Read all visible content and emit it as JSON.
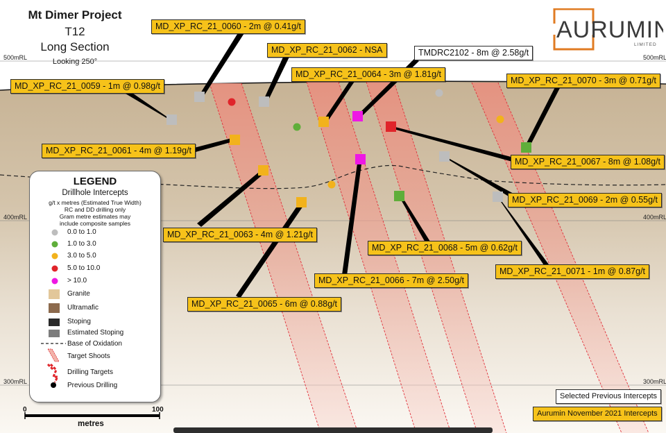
{
  "title": {
    "project": "Mt Dimer Project",
    "prospect": "T12",
    "section": "Long Section",
    "looking": "Looking 250°"
  },
  "logo": {
    "name": "AURUMIN",
    "sub": "LIMITED",
    "accent": "#e07b22"
  },
  "rl_labels": {
    "r500_left": "500mRL",
    "r500_right": "500mRL",
    "r400_left": "400mRL",
    "r400_right": "400mRL",
    "r300_left": "300mRL",
    "r300_right": "300mRL"
  },
  "intercepts": [
    {
      "id": "0060",
      "text": "MD_XP_RC_21_0060 - 2m @ 0.41g/t",
      "style": "yellow"
    },
    {
      "id": "0062",
      "text": "MD_XP_RC_21_0062 - NSA",
      "style": "yellow"
    },
    {
      "id": "tmdrc",
      "text": "TMDRC2102 - 8m @ 2.58g/t",
      "style": "white"
    },
    {
      "id": "0064",
      "text": "MD_XP_RC_21_0064 - 3m @ 1.81g/t",
      "style": "yellow"
    },
    {
      "id": "0059",
      "text": "MD_XP_RC_21_0059 - 1m @ 0.98g/t",
      "style": "yellow"
    },
    {
      "id": "0070",
      "text": "MD_XP_RC_21_0070 - 3m @ 0.71g/t",
      "style": "yellow"
    },
    {
      "id": "0061",
      "text": "MD_XP_RC_21_0061 - 4m @ 1.19g/t",
      "style": "yellow"
    },
    {
      "id": "0067",
      "text": "MD_XP_RC_21_0067 - 8m @ 1.08g/t",
      "style": "yellow"
    },
    {
      "id": "0069",
      "text": "MD_XP_RC_21_0069 - 2m @ 0.55g/t",
      "style": "yellow"
    },
    {
      "id": "0063",
      "text": "MD_XP_RC_21_0063 - 4m @ 1.21g/t",
      "style": "yellow"
    },
    {
      "id": "0068",
      "text": "MD_XP_RC_21_0068 - 5m @ 0.62g/t",
      "style": "yellow"
    },
    {
      "id": "0071",
      "text": "MD_XP_RC_21_0071 - 1m @ 0.87g/t",
      "style": "yellow"
    },
    {
      "id": "0066",
      "text": "MD_XP_RC_21_0066 - 7m @ 2.50g/t",
      "style": "yellow"
    },
    {
      "id": "0065",
      "text": "MD_XP_RC_21_0065 - 6m @ 0.88g/t",
      "style": "yellow"
    }
  ],
  "legend": {
    "title": "LEGEND",
    "subtitle": "Drillhole Intercepts",
    "notes": [
      "g/t x metres (Estimated True Width)",
      "RC and DD drilling only",
      "Gram metre estimates may",
      "include composite samples"
    ],
    "grades": [
      {
        "label": "0.0 to 1.0",
        "color": "#bdbdbd"
      },
      {
        "label": "1.0 to 3.0",
        "color": "#5fae3a"
      },
      {
        "label": "3.0 to 5.0",
        "color": "#f2b21c"
      },
      {
        "label": "5.0 to 10.0",
        "color": "#e0242a"
      },
      {
        "label": "> 10.0",
        "color": "#ee18e4"
      }
    ],
    "units": [
      {
        "label": "Granite",
        "color": "#e2c79a"
      },
      {
        "label": "Ultramafic",
        "color": "#8c6a4d"
      },
      {
        "label": "Stoping",
        "color": "#2a2a2a"
      },
      {
        "label": "Estimated Stoping",
        "color": "#7d7d7d"
      }
    ],
    "line_items": [
      {
        "label": "Base of Oxidation"
      },
      {
        "label": "Target Shoots"
      },
      {
        "label": "Drilling Targets"
      },
      {
        "label": "Previous Drilling"
      }
    ]
  },
  "scale": {
    "start": "0",
    "end": "100",
    "unit": "metres"
  },
  "keys": {
    "previous": "Selected Previous Intercepts",
    "aurumin": "Aurumin November 2021 Intercepts"
  },
  "colors": {
    "ground": "#c3ad8f",
    "shoot": "#ee9f91",
    "label_bg": "#f6c21a"
  }
}
